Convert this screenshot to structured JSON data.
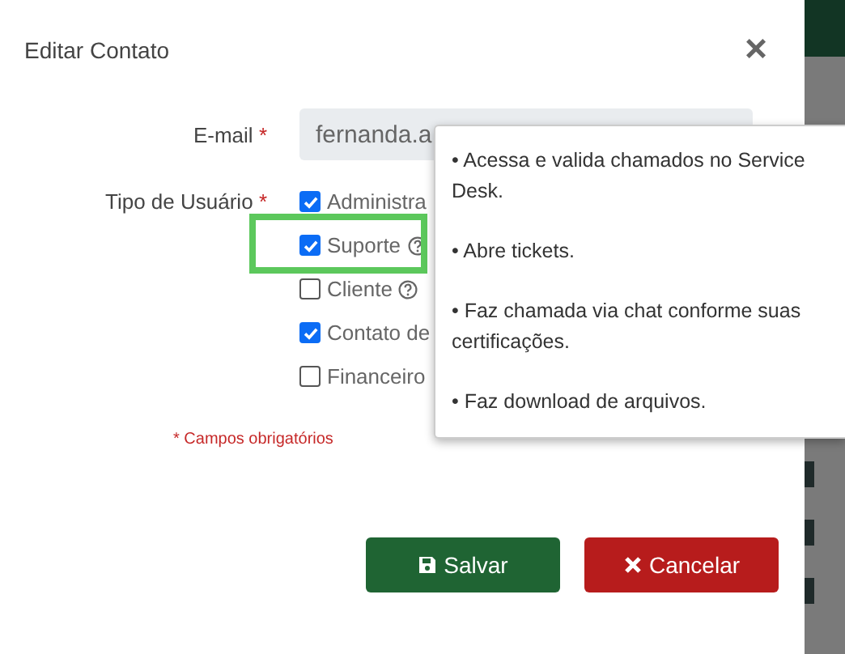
{
  "dialog": {
    "title": "Editar Contato",
    "close": "×"
  },
  "email": {
    "label": "E-mail",
    "required": "*",
    "value": "fernanda.a"
  },
  "user_type": {
    "label": "Tipo de Usuário",
    "required": "*",
    "options": [
      {
        "label": "Administra",
        "checked": true,
        "has_help": false,
        "highlighted": false
      },
      {
        "label": "Suporte",
        "checked": true,
        "has_help": true,
        "highlighted": true
      },
      {
        "label": "Cliente",
        "checked": false,
        "has_help": true,
        "highlighted": false
      },
      {
        "label": "Contato de",
        "checked": true,
        "has_help": false,
        "highlighted": false
      },
      {
        "label": "Financeiro",
        "checked": false,
        "has_help": false,
        "highlighted": false
      }
    ]
  },
  "required_note": "* Campos obrigatórios",
  "tooltip": {
    "lines": [
      "• Acessa e valida chamados no Service Desk.",
      "• Abre tickets.",
      "• Faz chamada via chat conforme suas certificações.",
      "• Faz download de arquivos."
    ]
  },
  "buttons": [
    {
      "label": "Salvar",
      "kind": "save"
    },
    {
      "label": "Cancelar",
      "kind": "cancel"
    }
  ]
}
